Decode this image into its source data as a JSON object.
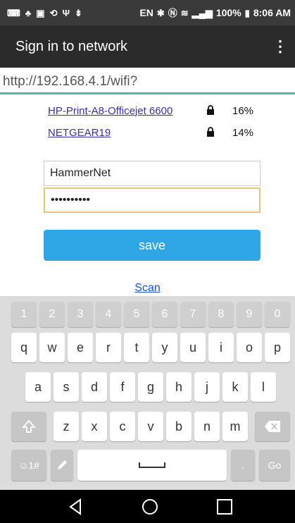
{
  "status_bar": {
    "language": "EN",
    "battery": "100%",
    "time": "8:06 AM"
  },
  "app_bar": {
    "title": "Sign in to network",
    "more_icon": "more-vert-icon"
  },
  "url_bar": {
    "url": "http://192.168.4.1/wifi?"
  },
  "networks": [
    {
      "ssid": "HP-Print-A8-Officejet 6600",
      "locked": true,
      "signal": "16%"
    },
    {
      "ssid": "NETGEAR19",
      "locked": true,
      "signal": "14%"
    }
  ],
  "form": {
    "ssid_value": "HammerNet",
    "password_value": "••••••••••",
    "save_label": "save",
    "scan_label": "Scan"
  },
  "keyboard": {
    "number_row": [
      "1",
      "2",
      "3",
      "4",
      "5",
      "6",
      "7",
      "8",
      "9",
      "0"
    ],
    "row1": [
      "q",
      "w",
      "e",
      "r",
      "t",
      "y",
      "u",
      "i",
      "o",
      "p"
    ],
    "row2": [
      "a",
      "s",
      "d",
      "f",
      "g",
      "h",
      "j",
      "k",
      "l"
    ],
    "row3": [
      "z",
      "x",
      "c",
      "v",
      "b",
      "n",
      "m"
    ],
    "symbols_label": "☺1#",
    "go_label": "Go"
  },
  "colors": {
    "accent": "#2fa7e6",
    "url_underline": "#5bb3a6",
    "link": "#3a2fa8"
  }
}
